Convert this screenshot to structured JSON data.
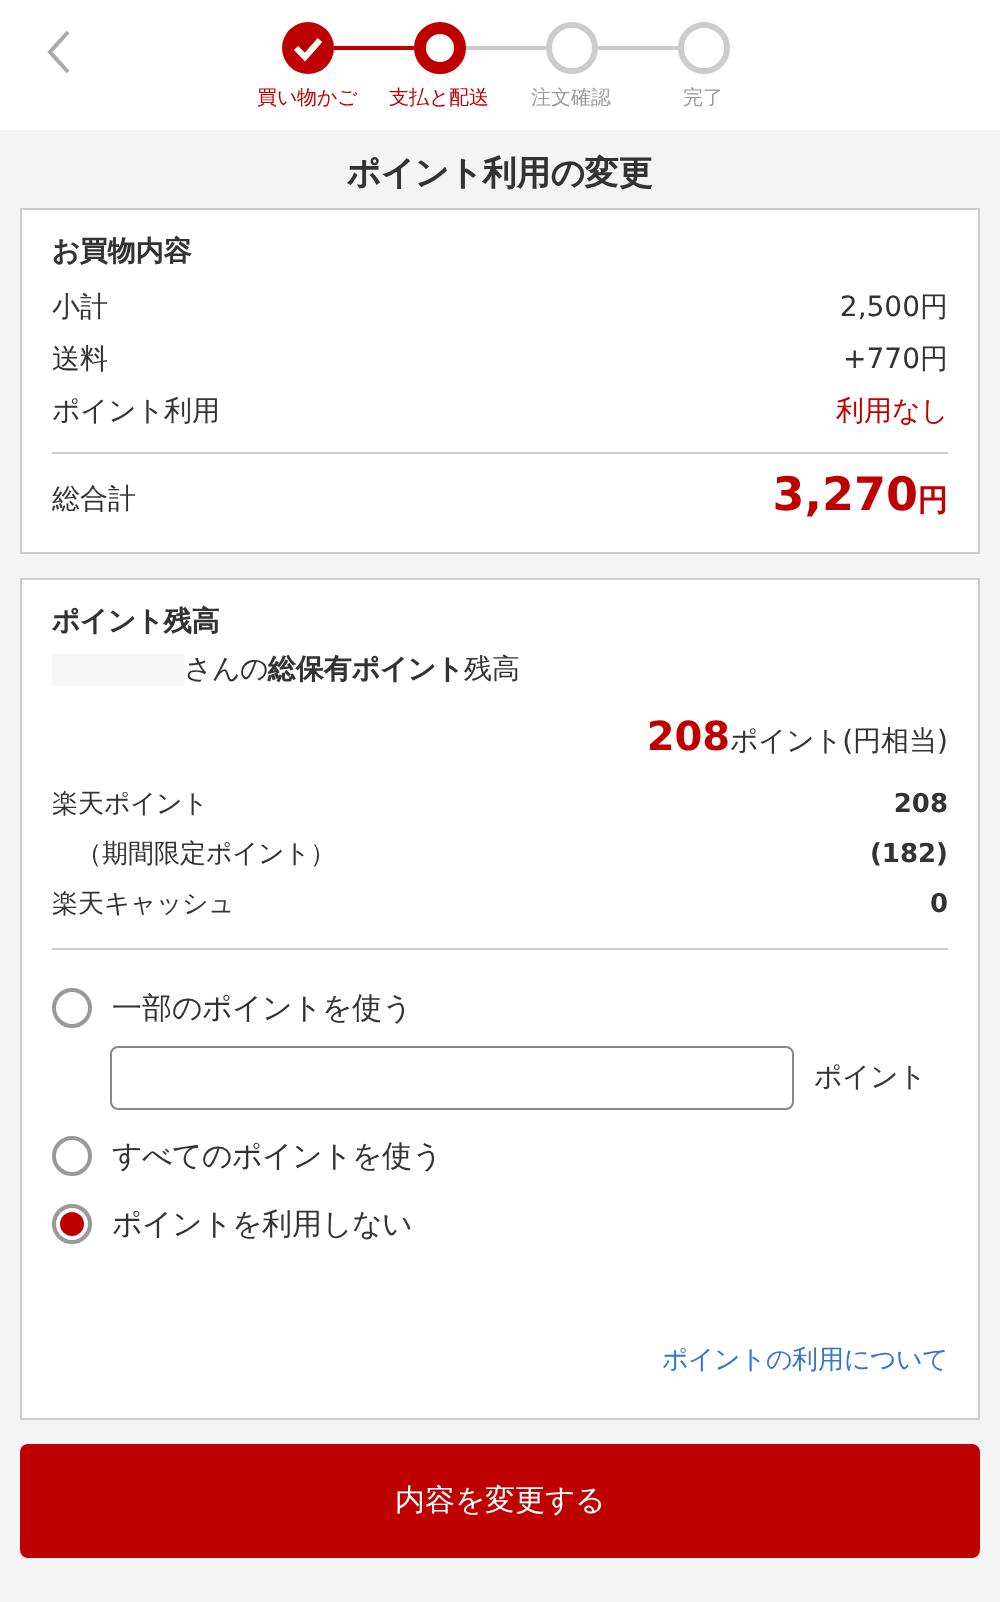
{
  "header": {
    "steps": [
      {
        "label": "買い物かご",
        "completed": true,
        "selected": false
      },
      {
        "label": "支払と配送",
        "completed": false,
        "selected": true
      },
      {
        "label": "注文確認",
        "completed": false,
        "selected": false
      },
      {
        "label": "完了",
        "completed": false,
        "selected": false
      }
    ]
  },
  "title": "ポイント利用の変更",
  "summary": {
    "heading": "お買物内容",
    "rows": [
      {
        "label": "小計",
        "value": "2,500円",
        "highlight": false
      },
      {
        "label": "送料",
        "value": "+770円",
        "highlight": false
      },
      {
        "label": "ポイント利用",
        "value": "利用なし",
        "highlight": true
      }
    ],
    "total": {
      "label": "総合計",
      "amount": "3,270",
      "unit": "円"
    }
  },
  "balance": {
    "heading": "ポイント残高",
    "owner_text": "さんの**総保有ポイント**残高",
    "points": "208",
    "points_unit": "ポイント(円相当)",
    "rows": [
      {
        "kind": "main",
        "label": "楽天ポイント",
        "value": "208"
      },
      {
        "kind": "sub",
        "label": "（期間限定ポイント）",
        "value": "(182)"
      },
      {
        "kind": "main",
        "label": "楽天キャッシュ",
        "value": "0"
      }
    ],
    "options": [
      {
        "kind": "input",
        "label": "一部のポイントを使う",
        "selected": false,
        "unit": "ポイント"
      },
      {
        "kind": "plain",
        "label": "すべてのポイントを使う",
        "selected": false
      },
      {
        "kind": "plain",
        "label": "ポイントを利用しない",
        "selected": true
      }
    ],
    "link": "ポイントの利用について"
  },
  "submit": "内容を変更する"
}
